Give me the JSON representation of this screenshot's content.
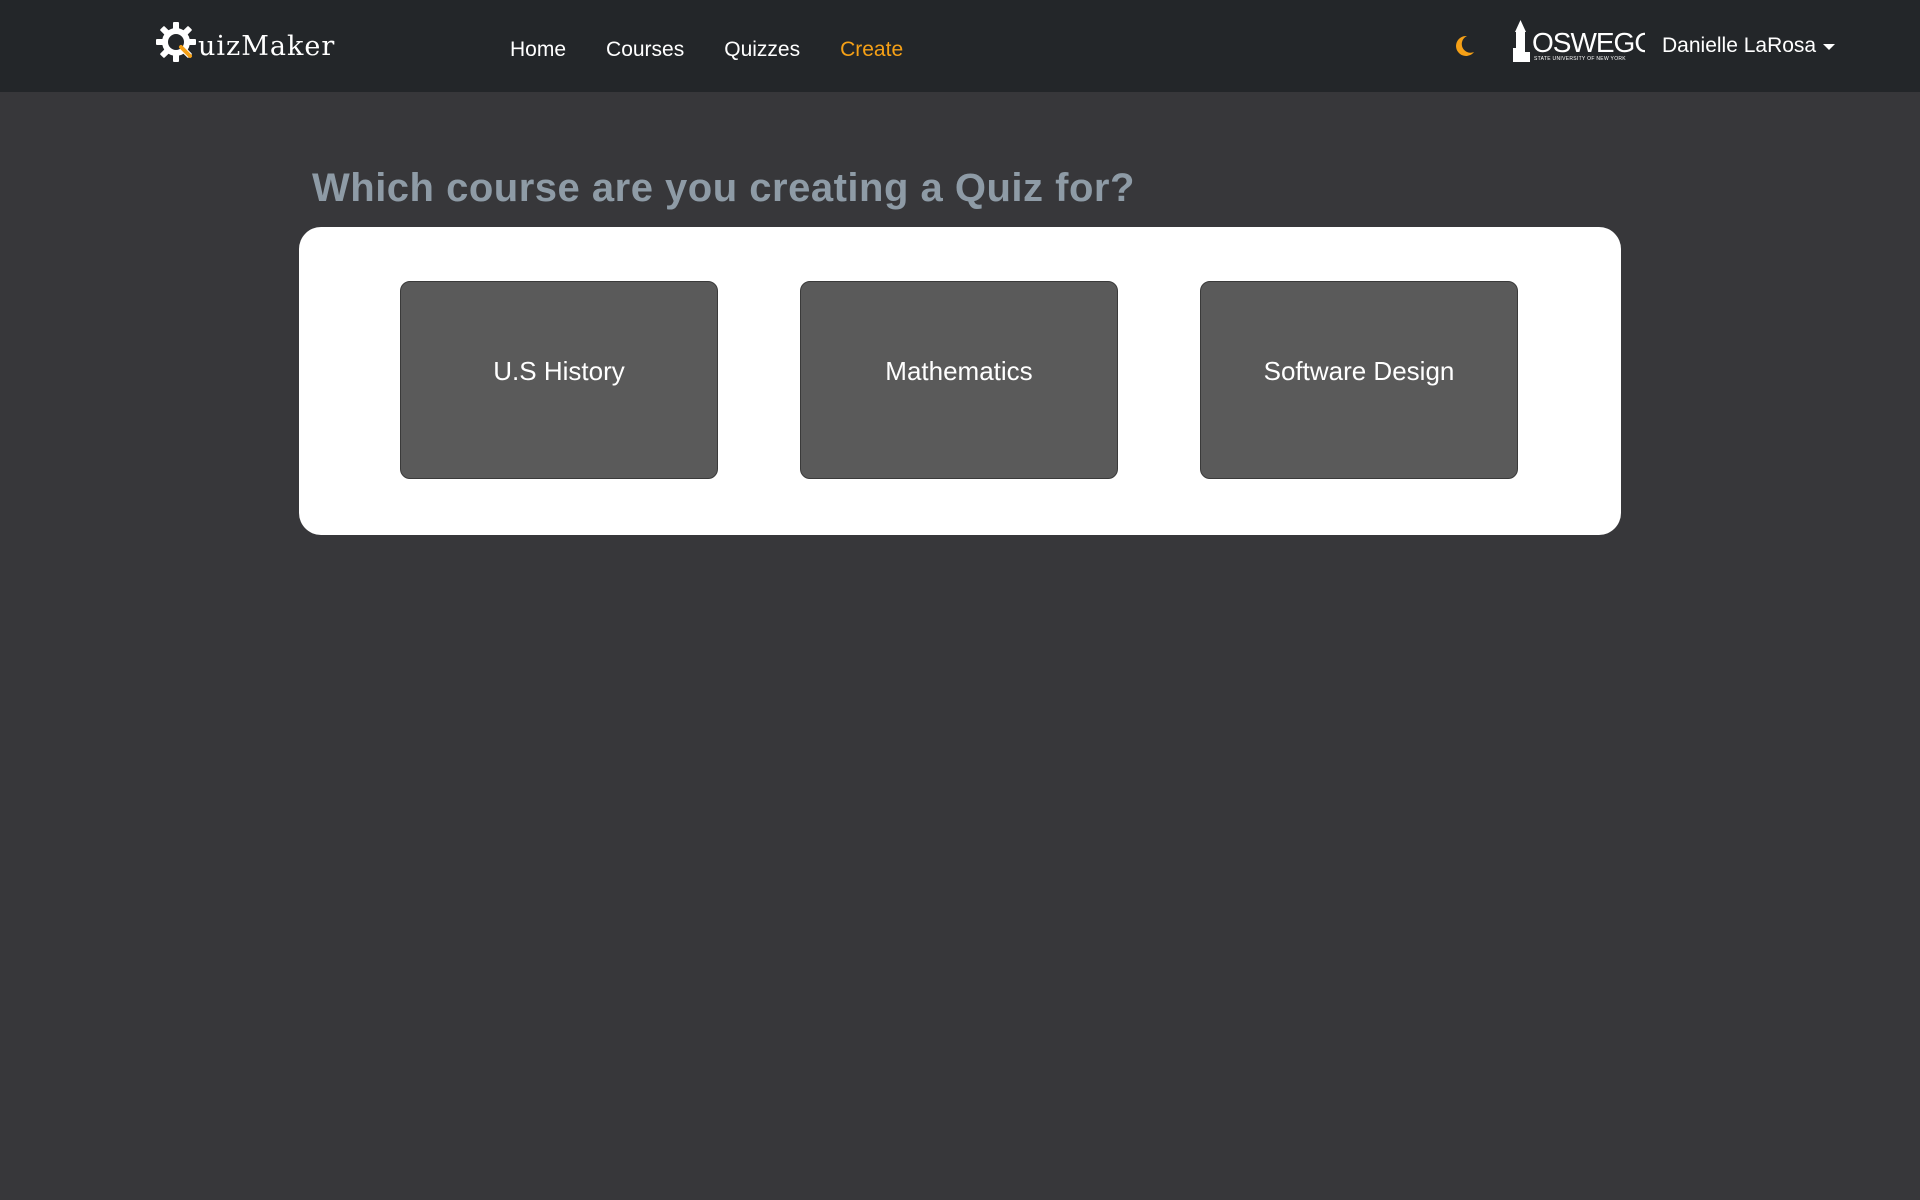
{
  "navbar": {
    "brand_text": "uizMaker",
    "links": [
      {
        "label": "Home",
        "active": false
      },
      {
        "label": "Courses",
        "active": false
      },
      {
        "label": "Quizzes",
        "active": false
      },
      {
        "label": "Create",
        "active": true
      }
    ],
    "theme_toggle_icon": "moon-icon",
    "institution_logo_text": "OSWEGO",
    "institution_logo_subtext": "STATE UNIVERSITY OF NEW YORK",
    "user_name": "Danielle LaRosa"
  },
  "main": {
    "title": "Which course are you creating a Quiz for?",
    "courses": [
      {
        "label": "U.S History"
      },
      {
        "label": "Mathematics"
      },
      {
        "label": "Software Design"
      }
    ]
  },
  "colors": {
    "navbar_bg": "#232629",
    "page_bg": "#37373a",
    "accent": "#f5a016",
    "title": "#8e9ba6",
    "card_bg": "#5a5a5a",
    "panel_bg": "#ffffff"
  }
}
